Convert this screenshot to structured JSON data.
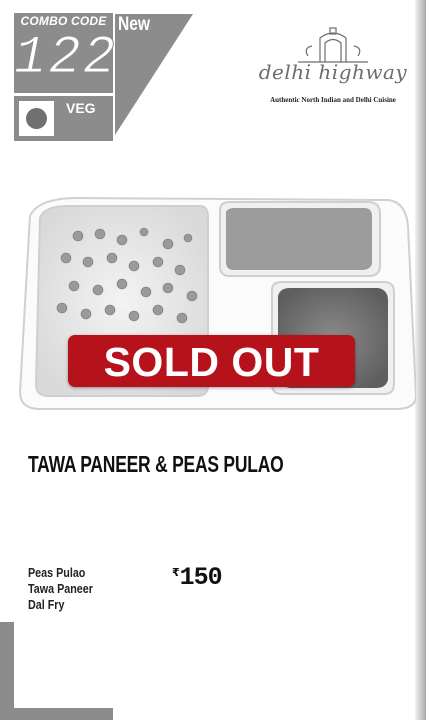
{
  "combo": {
    "label": "COMBO CODE",
    "code": "122"
  },
  "badge": {
    "new_label": "New"
  },
  "diet": {
    "label": "VEG"
  },
  "brand": {
    "name": "delhi highway",
    "tagline": "Authentic North Indian and Delhi Cuisine"
  },
  "status": {
    "label": "SOLD OUT"
  },
  "dish": {
    "title": "TAWA PANEER & PEAS PULAO",
    "items": [
      "Peas Pulao",
      "Tawa Paneer",
      "Dal Fry"
    ],
    "currency_symbol": "₹",
    "price": "150"
  },
  "colors": {
    "panel_gray": "#8c8c8c",
    "sold_out_red": "#b5121b",
    "brand_gray": "#6d6d6d"
  },
  "icons": [
    "gate-icon",
    "veg-dot-icon"
  ]
}
